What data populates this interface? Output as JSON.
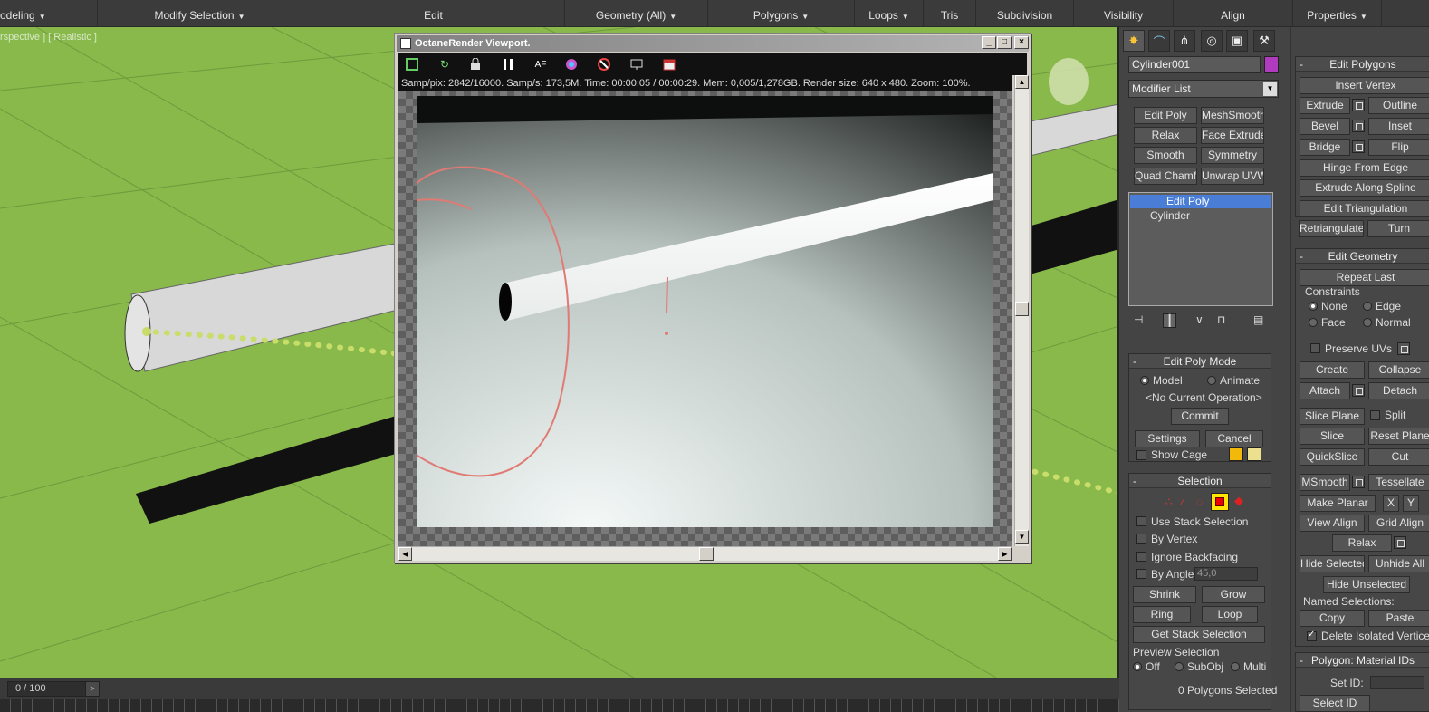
{
  "ribbon": {
    "items": [
      {
        "label": "odeling",
        "dropdown": true
      },
      {
        "label": "Modify Selection",
        "dropdown": true
      },
      {
        "label": "Edit",
        "dropdown": false
      },
      {
        "label": "Geometry (All)",
        "dropdown": true
      },
      {
        "label": "Polygons",
        "dropdown": true
      },
      {
        "label": "Loops",
        "dropdown": true
      },
      {
        "label": "Tris",
        "dropdown": false
      },
      {
        "label": "Subdivision",
        "dropdown": false
      },
      {
        "label": "Visibility",
        "dropdown": false
      },
      {
        "label": "Align",
        "dropdown": false
      },
      {
        "label": "Properties",
        "dropdown": true
      }
    ]
  },
  "viewport": {
    "label": "rspective ] [ Realistic ]",
    "time_counter": "0 / 100",
    "time_next": ">"
  },
  "octane": {
    "title": "OctaneRender Viewport.",
    "min": "_",
    "max": "□",
    "close": "×",
    "stats": "Samp/pix: 2842/16000.   Samp/s: 173,5M.   Time: 00:00:05 / 00:00:29.   Mem: 0,005/1,278GB.   Render size: 640 x 480.   Zoom: 100%.",
    "toolbar_icons": [
      "export-icon",
      "refresh-icon",
      "lock-icon",
      "pause-icon",
      "focus-picker-icon",
      "color-wheel-icon",
      "stop-icon",
      "display-icon",
      "calendar-icon"
    ]
  },
  "command_panel": {
    "object_name": "Cylinder001",
    "object_color": "#b03bbf",
    "modifier_list": "Modifier List",
    "modifier_buttons": [
      "Edit Poly",
      "MeshSmooth",
      "Relax",
      "Face Extrude",
      "Smooth",
      "Symmetry",
      "Quad Chamfer",
      "Unwrap UVW"
    ],
    "stack": [
      "Edit Poly",
      "Cylinder"
    ],
    "edit_poly_mode": {
      "title": "Edit Poly Mode",
      "model": "Model",
      "animate": "Animate",
      "current_op": "<No Current Operation>",
      "commit": "Commit",
      "settings": "Settings",
      "cancel": "Cancel",
      "show_cage": "Show Cage",
      "cage_color_1": "#f2b90a",
      "cage_color_2": "#ece08f"
    },
    "selection": {
      "title": "Selection",
      "use_stack": "Use Stack Selection",
      "by_vertex": "By Vertex",
      "ignore_backfacing": "Ignore Backfacing",
      "by_angle": "By Angle:",
      "angle_value": "45,0",
      "shrink": "Shrink",
      "grow": "Grow",
      "ring": "Ring",
      "loop": "Loop",
      "get_stack": "Get Stack Selection",
      "preview_label": "Preview Selection",
      "off": "Off",
      "subobj": "SubObj",
      "multi": "Multi",
      "status": "0 Polygons Selected"
    }
  },
  "right_panel": {
    "edit_polygons": {
      "title": "Edit Polygons",
      "insert_vertex": "Insert Vertex",
      "extrude": "Extrude",
      "outline": "Outline",
      "bevel": "Bevel",
      "inset": "Inset",
      "bridge": "Bridge",
      "flip": "Flip",
      "hinge": "Hinge From Edge",
      "extrude_spline": "Extrude Along Spline",
      "edit_tri": "Edit Triangulation",
      "retri": "Retriangulate",
      "turn": "Turn"
    },
    "edit_geometry": {
      "title": "Edit Geometry",
      "repeat_last": "Repeat Last",
      "constraints": "Constraints",
      "none": "None",
      "edge": "Edge",
      "face": "Face",
      "normal": "Normal",
      "preserve_uvs": "Preserve UVs",
      "create": "Create",
      "collapse": "Collapse",
      "attach": "Attach",
      "detach": "Detach",
      "slice_plane": "Slice Plane",
      "split": "Split",
      "slice": "Slice",
      "reset_plane": "Reset Plane",
      "quickslice": "QuickSlice",
      "cut": "Cut",
      "msmooth": "MSmooth",
      "tessellate": "Tessellate",
      "make_planar": "Make Planar",
      "x": "X",
      "y": "Y",
      "view_align": "View Align",
      "grid_align": "Grid Align",
      "relax": "Relax",
      "hide_selected": "Hide Selected",
      "unhide_all": "Unhide All",
      "hide_unselected": "Hide Unselected",
      "named_sel": "Named Selections:",
      "copy": "Copy",
      "paste": "Paste",
      "delete_isolated": "Delete Isolated Vertices"
    },
    "material_ids": {
      "title": "Polygon: Material IDs",
      "set_id": "Set ID:",
      "select_id": "Select ID"
    }
  }
}
